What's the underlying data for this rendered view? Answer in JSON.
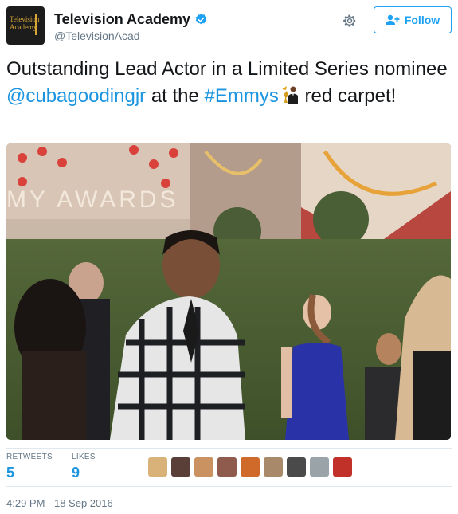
{
  "account": {
    "avatar_text": "Television Academy",
    "display_name": "Television Academy",
    "handle": "@TelevisionAcad",
    "verified": true
  },
  "actions": {
    "settings_icon": "gear-icon",
    "follow_label": "Follow",
    "follow_icon": "add-user-icon"
  },
  "tweet": {
    "text_part1": "Outstanding Lead Actor in a Limited Series nominee ",
    "mention": "@cubagoodingjr",
    "text_part2": " at the ",
    "hashtag": "#Emmys",
    "text_part3": " red carpet!",
    "emoji": "emmy-statue-emoji"
  },
  "stats": {
    "retweets_label": "RETWEETS",
    "retweets_value": "5",
    "likes_label": "LIKES",
    "likes_value": "9"
  },
  "timestamp": "4:29 PM - 18 Sep 2016",
  "colors": {
    "link": "#1b95e0",
    "follow_border": "#1da1f2",
    "muted": "#657786",
    "divider": "#e1e8ed"
  }
}
